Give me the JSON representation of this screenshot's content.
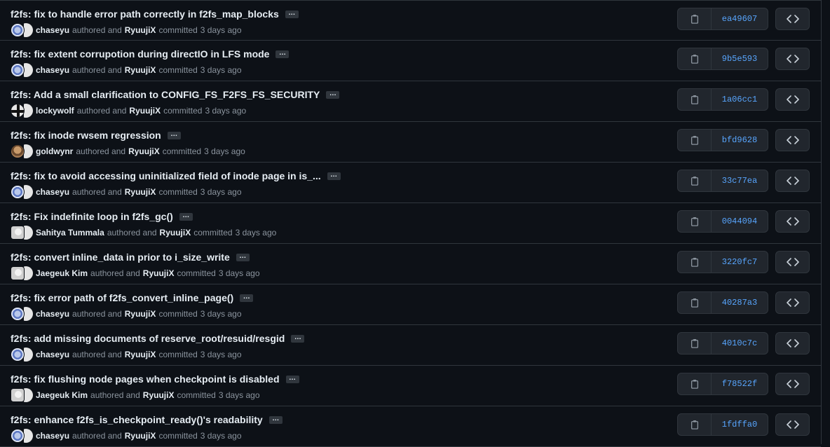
{
  "commits": [
    {
      "message": "f2fs: fix to handle error path correctly in f2fs_map_blocks",
      "author": "chaseyu",
      "committer": "RyuujiX",
      "time": "3 days ago",
      "sha": "ea49607",
      "author_avatar": "chaseyu"
    },
    {
      "message": "f2fs: fix extent corrupotion during directIO in LFS mode",
      "author": "chaseyu",
      "committer": "RyuujiX",
      "time": "3 days ago",
      "sha": "9b5e593",
      "author_avatar": "chaseyu"
    },
    {
      "message": "f2fs: Add a small clarification to CONFIG_FS_F2FS_FS_SECURITY",
      "author": "lockywolf",
      "committer": "RyuujiX",
      "time": "3 days ago",
      "sha": "1a06cc1",
      "author_avatar": "lockywolf"
    },
    {
      "message": "f2fs: fix inode rwsem regression",
      "author": "goldwynr",
      "committer": "RyuujiX",
      "time": "3 days ago",
      "sha": "bfd9628",
      "author_avatar": "goldwynr"
    },
    {
      "message": "f2fs: fix to avoid accessing uninitialized field of inode page in is_...",
      "author": "chaseyu",
      "committer": "RyuujiX",
      "time": "3 days ago",
      "sha": "33c77ea",
      "author_avatar": "chaseyu"
    },
    {
      "message": "f2fs: Fix indefinite loop in f2fs_gc()",
      "author": "Sahitya Tummala",
      "committer": "RyuujiX",
      "time": "3 days ago",
      "sha": "0044094",
      "author_avatar": "gray"
    },
    {
      "message": "f2fs: convert inline_data in prior to i_size_write",
      "author": "Jaegeuk Kim",
      "committer": "RyuujiX",
      "time": "3 days ago",
      "sha": "3220fc7",
      "author_avatar": "gray"
    },
    {
      "message": "f2fs: fix error path of f2fs_convert_inline_page()",
      "author": "chaseyu",
      "committer": "RyuujiX",
      "time": "3 days ago",
      "sha": "40287a3",
      "author_avatar": "chaseyu"
    },
    {
      "message": "f2fs: add missing documents of reserve_root/resuid/resgid",
      "author": "chaseyu",
      "committer": "RyuujiX",
      "time": "3 days ago",
      "sha": "4010c7c",
      "author_avatar": "chaseyu"
    },
    {
      "message": "f2fs: fix flushing node pages when checkpoint is disabled",
      "author": "Jaegeuk Kim",
      "committer": "RyuujiX",
      "time": "3 days ago",
      "sha": "f78522f",
      "author_avatar": "gray"
    },
    {
      "message": "f2fs: enhance f2fs_is_checkpoint_ready()'s readability",
      "author": "chaseyu",
      "committer": "RyuujiX",
      "time": "3 days ago",
      "sha": "1fdffa0",
      "author_avatar": "chaseyu"
    }
  ],
  "labels": {
    "authored_and": "authored and",
    "committed": "committed",
    "ellipsis": "…"
  },
  "icons": {
    "copy": "copy-icon",
    "browse": "code-icon",
    "ellipsis": "kebab-horizontal-icon"
  },
  "colors": {
    "background": "#0d1117",
    "border": "#30363d",
    "button_bg": "#21262d",
    "sha_link": "#58a6ff",
    "muted_text": "#8b949e",
    "primary_text": "#e6edf3"
  }
}
